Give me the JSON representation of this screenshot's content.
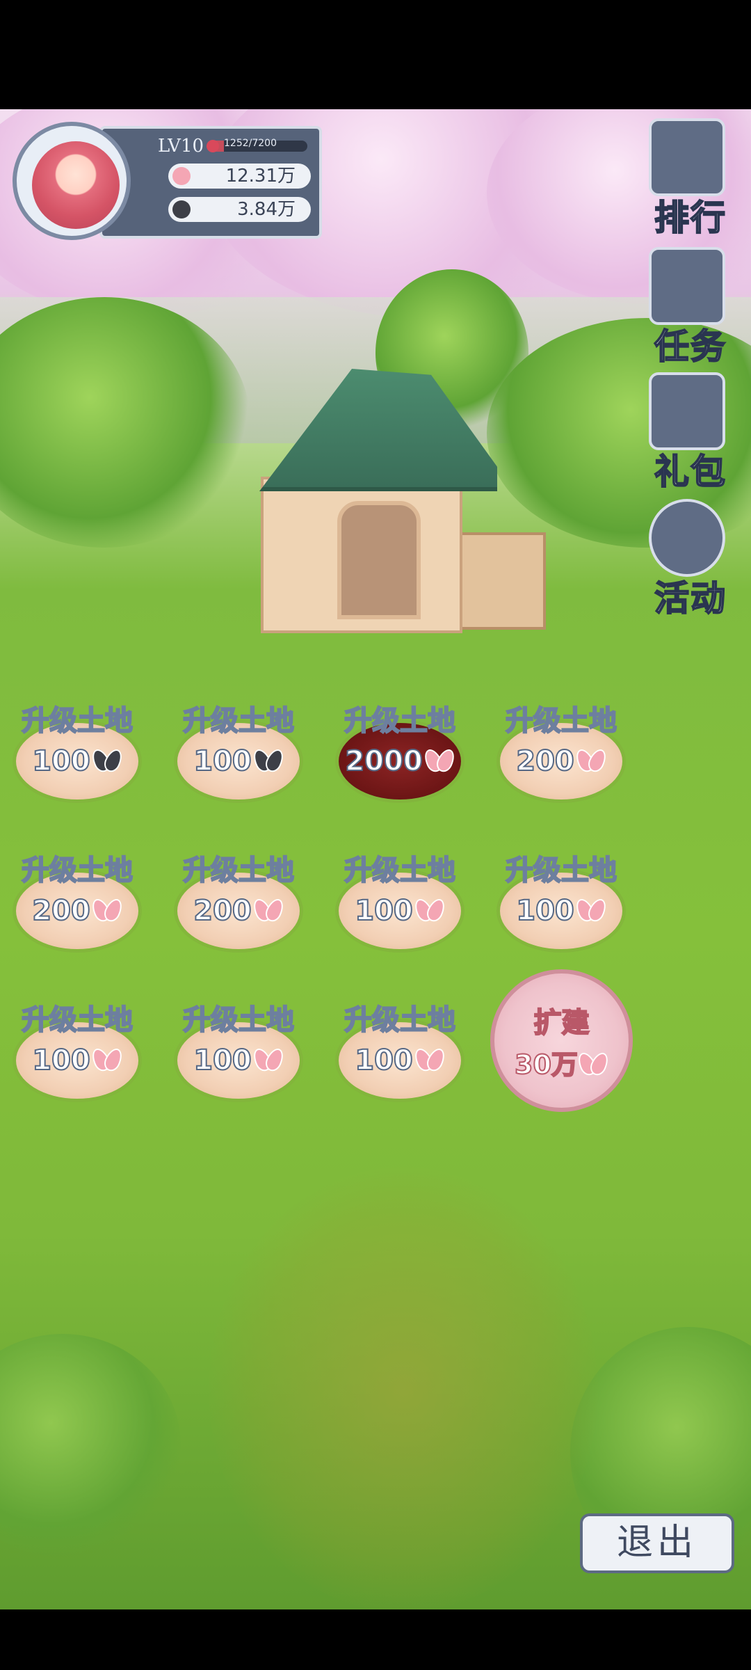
{
  "player": {
    "level": "LV10",
    "exp_text": "1252/7200",
    "exp_fraction": 0.174,
    "currency_pink": "12.31万",
    "currency_dark": "3.84万"
  },
  "side_menu": {
    "ranking": "排行",
    "tasks": "任务",
    "gift": "礼包",
    "events": "活动"
  },
  "plots": [
    {
      "title": "升级土地",
      "cost": "100",
      "currency": "dark",
      "state": "normal"
    },
    {
      "title": "升级土地",
      "cost": "100",
      "currency": "dark",
      "state": "normal"
    },
    {
      "title": "升级土地",
      "cost": "2000",
      "currency": "pink",
      "state": "dark"
    },
    {
      "title": "升级土地",
      "cost": "200",
      "currency": "pink",
      "state": "normal"
    },
    {
      "title": "升级土地",
      "cost": "200",
      "currency": "pink",
      "state": "normal"
    },
    {
      "title": "升级土地",
      "cost": "200",
      "currency": "pink",
      "state": "normal"
    },
    {
      "title": "升级土地",
      "cost": "100",
      "currency": "pink",
      "state": "normal"
    },
    {
      "title": "升级土地",
      "cost": "100",
      "currency": "pink",
      "state": "normal"
    },
    {
      "title": "升级土地",
      "cost": "100",
      "currency": "pink",
      "state": "normal"
    },
    {
      "title": "升级土地",
      "cost": "100",
      "currency": "pink",
      "state": "normal"
    },
    {
      "title": "升级土地",
      "cost": "100",
      "currency": "pink",
      "state": "normal"
    }
  ],
  "expand": {
    "label": "扩建",
    "cost": "30万"
  },
  "exit_label": "退出",
  "colors": {
    "pink_currency": "#f4a6b4",
    "dark_currency": "#3d3f47",
    "panel": "#56637a"
  }
}
